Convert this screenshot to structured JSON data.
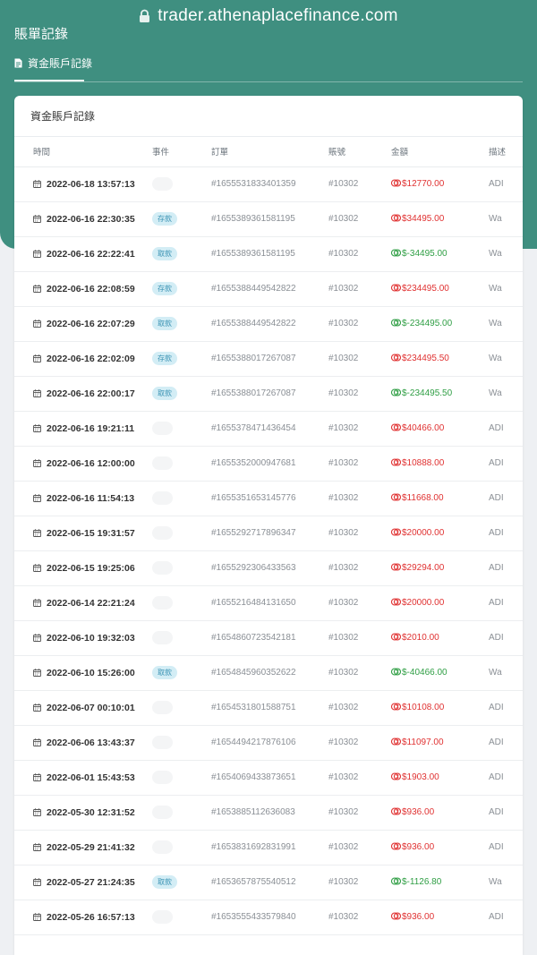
{
  "browser": {
    "url": "trader.athenaplacefinance.com"
  },
  "header": {
    "page_title": "賬單記錄",
    "tab_label": "資金賬戶記錄"
  },
  "card": {
    "title": "資金賬戶記錄"
  },
  "table": {
    "columns": [
      "時間",
      "事件",
      "訂單",
      "賬號",
      "金額",
      "描述"
    ],
    "rows": [
      {
        "time": "2022-06-18 13:57:13",
        "event": "",
        "event_type": "blank",
        "order": "#1655531833401359",
        "account": "#10302",
        "amount": "$12770.00",
        "sign": "neg",
        "desc": "ADI"
      },
      {
        "time": "2022-06-16 22:30:35",
        "event": "存款",
        "event_type": "deposit",
        "order": "#1655389361581195",
        "account": "#10302",
        "amount": "$34495.00",
        "sign": "neg",
        "desc": "Wa"
      },
      {
        "time": "2022-06-16 22:22:41",
        "event": "取款",
        "event_type": "withdraw",
        "order": "#1655389361581195",
        "account": "#10302",
        "amount": "$-34495.00",
        "sign": "pos",
        "desc": "Wa"
      },
      {
        "time": "2022-06-16 22:08:59",
        "event": "存款",
        "event_type": "deposit",
        "order": "#1655388449542822",
        "account": "#10302",
        "amount": "$234495.00",
        "sign": "neg",
        "desc": "Wa"
      },
      {
        "time": "2022-06-16 22:07:29",
        "event": "取款",
        "event_type": "withdraw",
        "order": "#1655388449542822",
        "account": "#10302",
        "amount": "$-234495.00",
        "sign": "pos",
        "desc": "Wa"
      },
      {
        "time": "2022-06-16 22:02:09",
        "event": "存款",
        "event_type": "deposit",
        "order": "#1655388017267087",
        "account": "#10302",
        "amount": "$234495.50",
        "sign": "neg",
        "desc": "Wa"
      },
      {
        "time": "2022-06-16 22:00:17",
        "event": "取款",
        "event_type": "withdraw",
        "order": "#1655388017267087",
        "account": "#10302",
        "amount": "$-234495.50",
        "sign": "pos",
        "desc": "Wa"
      },
      {
        "time": "2022-06-16 19:21:11",
        "event": "",
        "event_type": "blank",
        "order": "#1655378471436454",
        "account": "#10302",
        "amount": "$40466.00",
        "sign": "neg",
        "desc": "ADI"
      },
      {
        "time": "2022-06-16 12:00:00",
        "event": "",
        "event_type": "blank",
        "order": "#1655352000947681",
        "account": "#10302",
        "amount": "$10888.00",
        "sign": "neg",
        "desc": "ADI"
      },
      {
        "time": "2022-06-16 11:54:13",
        "event": "",
        "event_type": "blank",
        "order": "#1655351653145776",
        "account": "#10302",
        "amount": "$11668.00",
        "sign": "neg",
        "desc": "ADI"
      },
      {
        "time": "2022-06-15 19:31:57",
        "event": "",
        "event_type": "blank",
        "order": "#1655292717896347",
        "account": "#10302",
        "amount": "$20000.00",
        "sign": "neg",
        "desc": "ADI"
      },
      {
        "time": "2022-06-15 19:25:06",
        "event": "",
        "event_type": "blank",
        "order": "#1655292306433563",
        "account": "#10302",
        "amount": "$29294.00",
        "sign": "neg",
        "desc": "ADI"
      },
      {
        "time": "2022-06-14 22:21:24",
        "event": "",
        "event_type": "blank",
        "order": "#1655216484131650",
        "account": "#10302",
        "amount": "$20000.00",
        "sign": "neg",
        "desc": "ADI"
      },
      {
        "time": "2022-06-10 19:32:03",
        "event": "",
        "event_type": "blank",
        "order": "#1654860723542181",
        "account": "#10302",
        "amount": "$2010.00",
        "sign": "neg",
        "desc": "ADI"
      },
      {
        "time": "2022-06-10 15:26:00",
        "event": "取款",
        "event_type": "withdraw",
        "order": "#1654845960352622",
        "account": "#10302",
        "amount": "$-40466.00",
        "sign": "pos",
        "desc": "Wa"
      },
      {
        "time": "2022-06-07 00:10:01",
        "event": "",
        "event_type": "blank",
        "order": "#1654531801588751",
        "account": "#10302",
        "amount": "$10108.00",
        "sign": "neg",
        "desc": "ADI"
      },
      {
        "time": "2022-06-06 13:43:37",
        "event": "",
        "event_type": "blank",
        "order": "#1654494217876106",
        "account": "#10302",
        "amount": "$11097.00",
        "sign": "neg",
        "desc": "ADI"
      },
      {
        "time": "2022-06-01 15:43:53",
        "event": "",
        "event_type": "blank",
        "order": "#1654069433873651",
        "account": "#10302",
        "amount": "$1903.00",
        "sign": "neg",
        "desc": "ADI"
      },
      {
        "time": "2022-05-30 12:31:52",
        "event": "",
        "event_type": "blank",
        "order": "#1653885112636083",
        "account": "#10302",
        "amount": "$936.00",
        "sign": "neg",
        "desc": "ADI"
      },
      {
        "time": "2022-05-29 21:41:32",
        "event": "",
        "event_type": "blank",
        "order": "#1653831692831991",
        "account": "#10302",
        "amount": "$936.00",
        "sign": "neg",
        "desc": "ADI"
      },
      {
        "time": "2022-05-27 21:24:35",
        "event": "取款",
        "event_type": "withdraw",
        "order": "#1653657875540512",
        "account": "#10302",
        "amount": "$-1126.80",
        "sign": "pos",
        "desc": "Wa"
      },
      {
        "time": "2022-05-26 16:57:13",
        "event": "",
        "event_type": "blank",
        "order": "#1653555433579840",
        "account": "#10302",
        "amount": "$936.00",
        "sign": "neg",
        "desc": "ADI"
      }
    ]
  },
  "colors": {
    "header_bg": "#3f8f80",
    "negative_amount": "#e03131",
    "positive_amount": "#2f9e44",
    "badge_bg": "#d3edf5"
  },
  "icons": {
    "lock": "lock-icon",
    "tab": "document-icon",
    "date": "calendar-icon",
    "amount": "money-icon"
  }
}
